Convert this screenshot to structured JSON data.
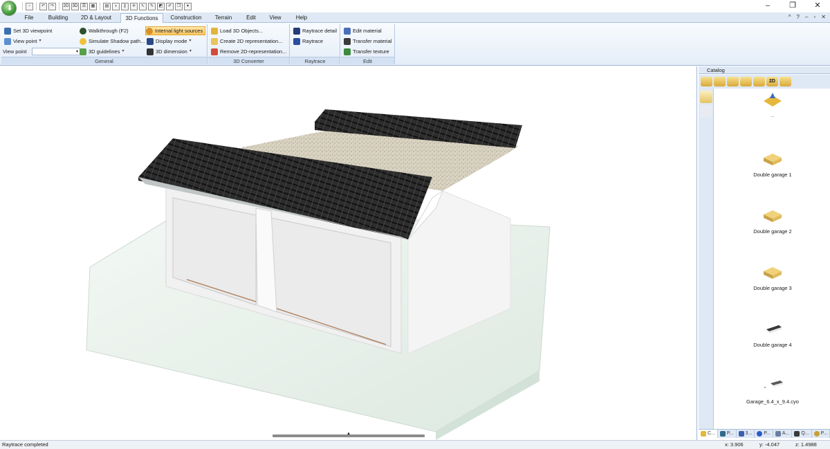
{
  "window": {
    "minimize": "–",
    "restore": "❐",
    "close": "✕"
  },
  "quick_access": {
    "buttons": [
      "new-icon",
      "undo-icon",
      "redo-icon",
      "2D",
      "3D",
      "wall-icon",
      "window-icon",
      "grid-icon",
      "3d-icon",
      "select-icon",
      "dimension-icon",
      "cut-icon",
      "move-icon",
      "paint-icon",
      "copy-icon"
    ],
    "label_2d": "2D",
    "label_3d": "3D",
    "customize": "▾"
  },
  "menu": {
    "tabs": [
      {
        "label": "File"
      },
      {
        "label": "Building"
      },
      {
        "label": "2D & Layout"
      },
      {
        "label": "3D Functions"
      },
      {
        "label": "Construction"
      },
      {
        "label": "Terrain"
      },
      {
        "label": "Edit"
      },
      {
        "label": "View"
      },
      {
        "label": "Help"
      }
    ],
    "active_tab": "3D Functions",
    "right_icons": [
      "^",
      "?",
      "–",
      "▫",
      "✕"
    ]
  },
  "ribbon": {
    "groups": {
      "general": {
        "title": "General",
        "set_viewpoint": "Set 3D viewpoint",
        "view_point_btn": "View point",
        "view_point_label": "View point",
        "view_point_value": "",
        "walkthrough": "Walkthrough (F2)",
        "simulate_shadow": "Simulate Shadow path...",
        "guidelines": "3D guidelines",
        "internal_lights": "Internal light sources",
        "display_mode": "Display mode",
        "dimension": "3D dimension"
      },
      "converter": {
        "title": "3D Converter",
        "load_objects": "Load 3D Objects...",
        "create_2d": "Create 2D representation...",
        "remove_2d": "Remove 2D-representation..."
      },
      "raytrace": {
        "title": "Raytrace",
        "detail": "Raytrace detail",
        "raytrace": "Raytrace"
      },
      "edit": {
        "title": "Edit",
        "edit_material": "Edit material",
        "transfer_material": "Transfer material",
        "transfer_texture": "Transfer texture"
      }
    }
  },
  "catalog": {
    "title": "Catalog",
    "toolbar_2d": "2D",
    "items": [
      {
        "label": ".."
      },
      {
        "label": "Double garage 1"
      },
      {
        "label": "Double garage 2"
      },
      {
        "label": "Double garage 3"
      },
      {
        "label": "Double garage 4"
      },
      {
        "label": "Garage_6.4_x_9.4.cyo"
      }
    ],
    "bottom_tabs": [
      {
        "label": "C..."
      },
      {
        "label": "P..."
      },
      {
        "label": "3..."
      },
      {
        "label": "P..."
      },
      {
        "label": "A..."
      },
      {
        "label": "Q..."
      },
      {
        "label": "P..."
      }
    ]
  },
  "status": {
    "message": "Raytrace completed",
    "x": "x: 3.906",
    "y": "y: -4.047",
    "z": "z: 1.4988"
  },
  "colors": {
    "ribbon_bg": "#e4edf8",
    "tab_bar": "#dfe9f5",
    "highlight": "#ffc75e",
    "roof_tiles": "#2e2e2e",
    "gravel": "#d9d3c3",
    "wall": "#f2f2f2",
    "base_slab": "#e6f0ea"
  }
}
